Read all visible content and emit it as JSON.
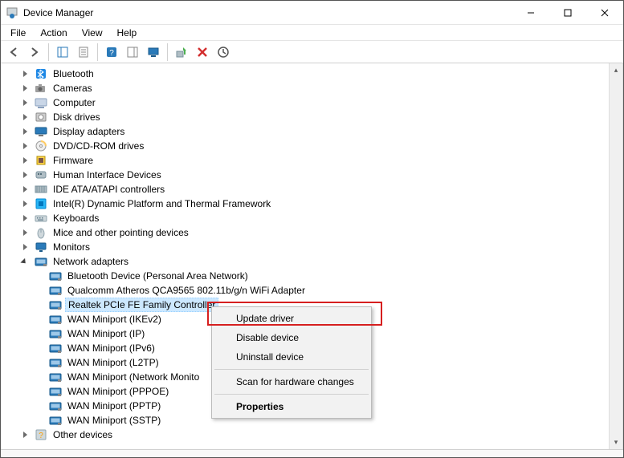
{
  "window": {
    "title": "Device Manager"
  },
  "menubar": [
    "File",
    "Action",
    "View",
    "Help"
  ],
  "toolbar": [
    {
      "n": "back-icon"
    },
    {
      "n": "forward-icon"
    },
    {
      "sep": true
    },
    {
      "n": "up-tree-icon"
    },
    {
      "n": "properties-icon"
    },
    {
      "sep": true
    },
    {
      "n": "help-icon"
    },
    {
      "n": "show-hidden-icon"
    },
    {
      "n": "devices-by-type-icon"
    },
    {
      "sep": true
    },
    {
      "n": "update-driver-icon"
    },
    {
      "n": "uninstall-icon"
    },
    {
      "n": "scan-hardware-icon"
    }
  ],
  "tree": [
    {
      "lvl": 1,
      "exp": "right",
      "icon": "bluetooth",
      "label": "Bluetooth"
    },
    {
      "lvl": 1,
      "exp": "right",
      "icon": "camera",
      "label": "Cameras"
    },
    {
      "lvl": 1,
      "exp": "right",
      "icon": "computer",
      "label": "Computer"
    },
    {
      "lvl": 1,
      "exp": "right",
      "icon": "disk",
      "label": "Disk drives"
    },
    {
      "lvl": 1,
      "exp": "right",
      "icon": "display",
      "label": "Display adapters"
    },
    {
      "lvl": 1,
      "exp": "right",
      "icon": "dvd",
      "label": "DVD/CD-ROM drives"
    },
    {
      "lvl": 1,
      "exp": "right",
      "icon": "firmware",
      "label": "Firmware"
    },
    {
      "lvl": 1,
      "exp": "right",
      "icon": "hid",
      "label": "Human Interface Devices"
    },
    {
      "lvl": 1,
      "exp": "right",
      "icon": "ide",
      "label": "IDE ATA/ATAPI controllers"
    },
    {
      "lvl": 1,
      "exp": "right",
      "icon": "intel",
      "label": "Intel(R) Dynamic Platform and Thermal Framework"
    },
    {
      "lvl": 1,
      "exp": "right",
      "icon": "keyboard",
      "label": "Keyboards"
    },
    {
      "lvl": 1,
      "exp": "right",
      "icon": "mouse",
      "label": "Mice and other pointing devices"
    },
    {
      "lvl": 1,
      "exp": "right",
      "icon": "monitor",
      "label": "Monitors"
    },
    {
      "lvl": 1,
      "exp": "down",
      "icon": "network",
      "label": "Network adapters"
    },
    {
      "lvl": 2,
      "icon": "network",
      "label": "Bluetooth Device (Personal Area Network)"
    },
    {
      "lvl": 2,
      "icon": "network",
      "label": "Qualcomm Atheros QCA9565 802.11b/g/n WiFi Adapter"
    },
    {
      "lvl": 2,
      "icon": "network",
      "label": "Realtek PCIe FE Family Controller",
      "selected": true
    },
    {
      "lvl": 2,
      "icon": "network",
      "label": "WAN Miniport (IKEv2)"
    },
    {
      "lvl": 2,
      "icon": "network",
      "label": "WAN Miniport (IP)"
    },
    {
      "lvl": 2,
      "icon": "network",
      "label": "WAN Miniport (IPv6)"
    },
    {
      "lvl": 2,
      "icon": "network",
      "label": "WAN Miniport (L2TP)"
    },
    {
      "lvl": 2,
      "icon": "network",
      "label": "WAN Miniport (Network Monito"
    },
    {
      "lvl": 2,
      "icon": "network",
      "label": "WAN Miniport (PPPOE)"
    },
    {
      "lvl": 2,
      "icon": "network",
      "label": "WAN Miniport (PPTP)"
    },
    {
      "lvl": 2,
      "icon": "network",
      "label": "WAN Miniport (SSTP)"
    },
    {
      "lvl": 1,
      "exp": "right",
      "icon": "other",
      "label": "Other devices"
    }
  ],
  "ctx": {
    "items": [
      {
        "label": "Update driver",
        "highlight": true
      },
      {
        "label": "Disable device"
      },
      {
        "label": "Uninstall device"
      },
      {
        "sep": true
      },
      {
        "label": "Scan for hardware changes"
      },
      {
        "sep": true
      },
      {
        "label": "Properties",
        "bold": true
      }
    ]
  }
}
